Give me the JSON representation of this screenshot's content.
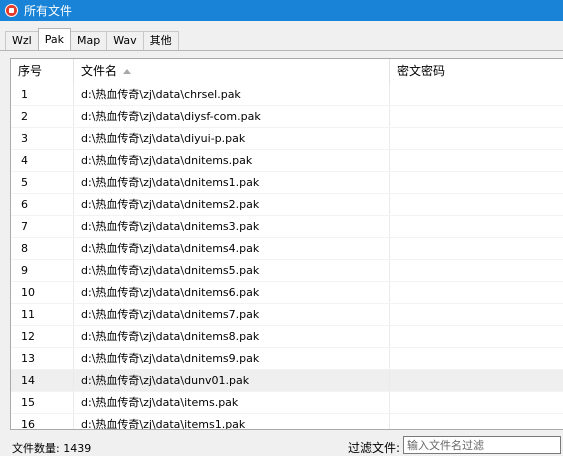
{
  "window": {
    "title": "所有文件"
  },
  "tabs": [
    {
      "label": "Wzl",
      "active": false
    },
    {
      "label": "Pak",
      "active": true
    },
    {
      "label": "Map",
      "active": false
    },
    {
      "label": "Wav",
      "active": false
    },
    {
      "label": "其他",
      "active": false
    }
  ],
  "table": {
    "headers": [
      "序号",
      "文件名",
      "密文密码"
    ],
    "sort_column": "文件名",
    "sort_direction": "ascending",
    "selected_row": 14,
    "rows": [
      {
        "idx": "1",
        "path": "d:\\热血传奇\\zj\\data\\chrsel.pak",
        "pwd": ""
      },
      {
        "idx": "2",
        "path": "d:\\热血传奇\\zj\\data\\diysf-com.pak",
        "pwd": ""
      },
      {
        "idx": "3",
        "path": "d:\\热血传奇\\zj\\data\\diyui-p.pak",
        "pwd": ""
      },
      {
        "idx": "4",
        "path": "d:\\热血传奇\\zj\\data\\dnitems.pak",
        "pwd": ""
      },
      {
        "idx": "5",
        "path": "d:\\热血传奇\\zj\\data\\dnitems1.pak",
        "pwd": ""
      },
      {
        "idx": "6",
        "path": "d:\\热血传奇\\zj\\data\\dnitems2.pak",
        "pwd": ""
      },
      {
        "idx": "7",
        "path": "d:\\热血传奇\\zj\\data\\dnitems3.pak",
        "pwd": ""
      },
      {
        "idx": "8",
        "path": "d:\\热血传奇\\zj\\data\\dnitems4.pak",
        "pwd": ""
      },
      {
        "idx": "9",
        "path": "d:\\热血传奇\\zj\\data\\dnitems5.pak",
        "pwd": ""
      },
      {
        "idx": "10",
        "path": "d:\\热血传奇\\zj\\data\\dnitems6.pak",
        "pwd": ""
      },
      {
        "idx": "11",
        "path": "d:\\热血传奇\\zj\\data\\dnitems7.pak",
        "pwd": ""
      },
      {
        "idx": "12",
        "path": "d:\\热血传奇\\zj\\data\\dnitems8.pak",
        "pwd": ""
      },
      {
        "idx": "13",
        "path": "d:\\热血传奇\\zj\\data\\dnitems9.pak",
        "pwd": ""
      },
      {
        "idx": "14",
        "path": "d:\\热血传奇\\zj\\data\\dunv01.pak",
        "pwd": ""
      },
      {
        "idx": "15",
        "path": "d:\\热血传奇\\zj\\data\\items.pak",
        "pwd": ""
      },
      {
        "idx": "16",
        "path": "d:\\热血传奇\\zj\\data\\items1.pak",
        "pwd": ""
      }
    ]
  },
  "footer": {
    "count_text": "文件数量: 1439",
    "filter_label": "过滤文件:",
    "filter_placeholder": "输入文件名过滤",
    "filter_value": ""
  },
  "icons": {
    "app": "app-icon",
    "sort": "sort-ascending-icon"
  }
}
